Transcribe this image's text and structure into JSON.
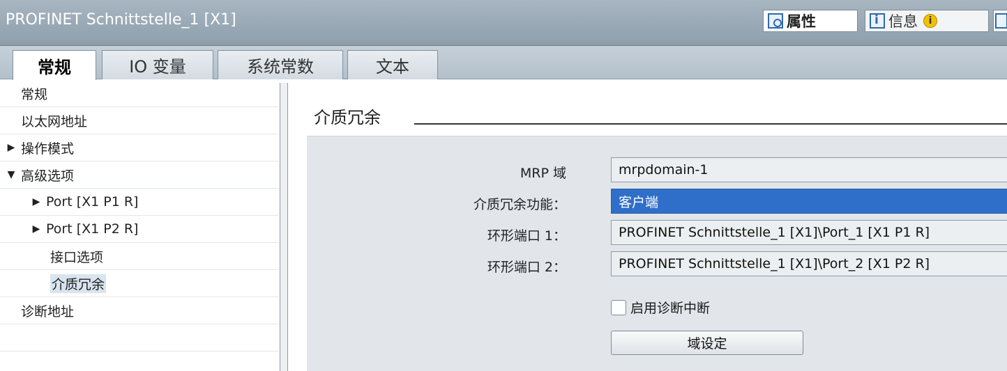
{
  "window": {
    "title": "PROFINET Schnittstelle_1 [X1]",
    "inspector_tabs": [
      {
        "label": "属性",
        "icon": "properties-icon"
      },
      {
        "label": "信息",
        "icon": "info-icon",
        "badge_icon": "info-badge-icon"
      },
      {
        "label": "",
        "icon": "diagnostics-icon"
      }
    ]
  },
  "tabs": [
    {
      "label": "常规"
    },
    {
      "label": "IO 变量"
    },
    {
      "label": "系统常数"
    },
    {
      "label": "文本"
    }
  ],
  "nav": {
    "items": [
      {
        "label": "常规"
      },
      {
        "label": "以太网地址"
      },
      {
        "label": "操作模式"
      },
      {
        "label": "高级选项"
      },
      {
        "label": "Port [X1 P1 R]"
      },
      {
        "label": "Port [X1 P2 R]"
      },
      {
        "label": "接口选项"
      },
      {
        "label": "介质冗余"
      },
      {
        "label": "诊断地址"
      }
    ]
  },
  "section": {
    "title": "介质冗余",
    "mrp_domain_label": "MRP 域",
    "mrp_domain_value": "mrpdomain-1",
    "role_label": "介质冗余功能：",
    "role_value": "客户端",
    "ring_port1_label": "环形端口 1：",
    "ring_port1_value": "PROFINET Schnittstelle_1 [X1]\\Port_1 [X1 P1 R]",
    "ring_port2_label": "环形端口 2：",
    "ring_port2_value": "PROFINET Schnittstelle_1 [X1]\\Port_2 [X1 P2 R]",
    "diag_interrupt_label": "启用诊断中断",
    "diag_interrupt_checked": false,
    "domain_settings_button": "域设定"
  },
  "colors": {
    "title_bar": "#98a8b5",
    "selection": "#2f6fc9",
    "group_bg": "#e2e6ea"
  }
}
